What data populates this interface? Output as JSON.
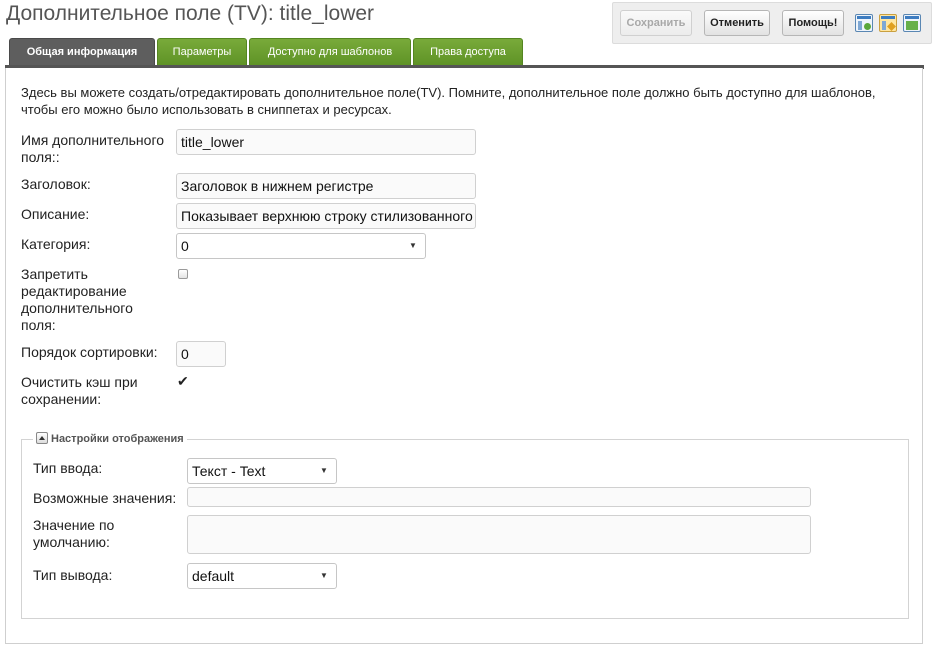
{
  "header": {
    "title": "Дополнительное поле (TV): title_lower"
  },
  "toolbar": {
    "save_label": "Сохранить",
    "cancel_label": "Отменить",
    "help_label": "Помощь!"
  },
  "tabs": [
    {
      "label": "Общая информация",
      "active": true
    },
    {
      "label": "Параметры",
      "active": false
    },
    {
      "label": "Доступно для шаблонов",
      "active": false
    },
    {
      "label": "Права доступа",
      "active": false
    }
  ],
  "intro": {
    "text": "Здесь вы можете создать/отредактировать дополнительное поле(TV). Помните, дополнительное поле должно быть доступно для шаблонов, чтобы его можно было использовать в сниппетах и ресурсах."
  },
  "form": {
    "name": {
      "label": "Имя дополнительного поля::",
      "value": "title_lower"
    },
    "caption": {
      "label": "Заголовок:",
      "value": "Заголовок в нижнем регистре"
    },
    "description": {
      "label": "Описание:",
      "value": "Показывает верхнюю строку стилизованного"
    },
    "category": {
      "label": "Категория:",
      "value": "0"
    },
    "lock": {
      "label": "Запретить редактирование дополнительного поля:",
      "checked": false
    },
    "rank": {
      "label": "Порядок сортировки:",
      "value": "0"
    },
    "clear_cache": {
      "label": "Очистить кэш при сохранении:",
      "checked": true
    }
  },
  "display_settings": {
    "legend": "Настройки отображения",
    "input_type": {
      "label": "Тип ввода:",
      "value": "Текст - Text"
    },
    "input_options": {
      "label": "Возможные значения:",
      "value": ""
    },
    "default_value": {
      "label": "Значение по умолчанию:",
      "value": ""
    },
    "output_type": {
      "label": "Тип вывода:",
      "value": "default"
    }
  },
  "colors": {
    "tab_active": "#5e5e5e",
    "tab_inactive": "#6b9f2f",
    "title": "#555555"
  }
}
